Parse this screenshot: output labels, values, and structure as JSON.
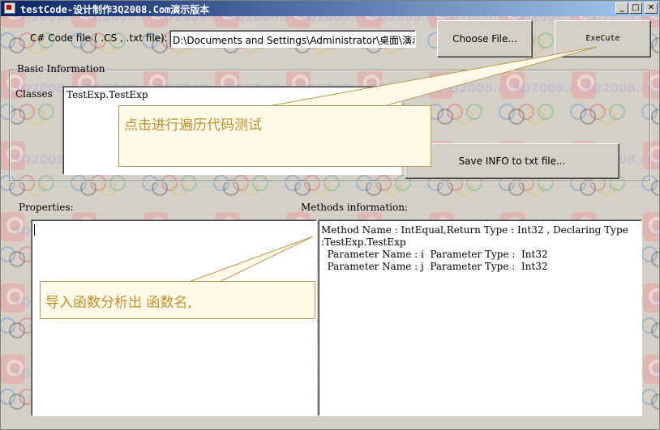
{
  "window": {
    "title": "testCode-设计制作3Q2008.Com演示版本"
  },
  "titlebar_buttons": {
    "minimize": "_",
    "maximize": "□",
    "close": "✕"
  },
  "file_row": {
    "label": "C# Code file ( .CS , .txt file):",
    "path_value": "D:\\Documents and Settings\\Administrator\\桌面\\演示",
    "choose_button": "Choose File...",
    "execute_button": "ExeCute"
  },
  "basic_info": {
    "group_title": "Basic Information",
    "classes_label": "Classes",
    "classes_value": "TestExp.TestExp",
    "save_button": "Save INFO to txt file..."
  },
  "properties": {
    "label": "Properties:"
  },
  "methods": {
    "label": "Methods information:",
    "lines": [
      "Method Name : IntEqual,Return Type : Int32 , Declaring Type",
      ":TestExp.TestExp",
      "  Parameter Name : i  Parameter Type :  Int32",
      "  Parameter Name : j  Parameter Type :  Int32"
    ]
  },
  "callouts": {
    "execute_tip": "点击进行遍历代码测试",
    "properties_tip": "导入函数分析出  函数名,"
  },
  "watermark": {
    "text": "3Q2008.com",
    "icon": "logo-icon"
  }
}
